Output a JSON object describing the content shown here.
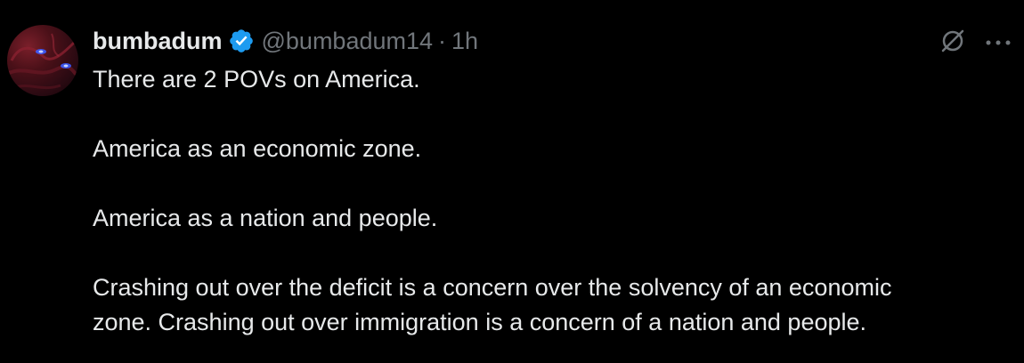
{
  "post": {
    "display_name": "bumbadum",
    "handle": "@bumbadum14",
    "separator": "·",
    "time": "1h",
    "verified_icon": "verified-badge-icon",
    "actions": {
      "grok_icon": "grok-icon",
      "more_icon": "more-options-icon"
    },
    "text": {
      "line1": "There are 2 POVs on America.",
      "line2": "America as an economic zone.",
      "line3": "America as a nation and people.",
      "line4a": "Crashing out over the deficit is a concern over the solvency of an economic",
      "line4b": "zone. Crashing out over immigration is a concern of a nation and people."
    }
  },
  "colors": {
    "background": "#000000",
    "text": "#e7e9ea",
    "secondary": "#71767b",
    "verified_blue": "#1d9bf0"
  }
}
